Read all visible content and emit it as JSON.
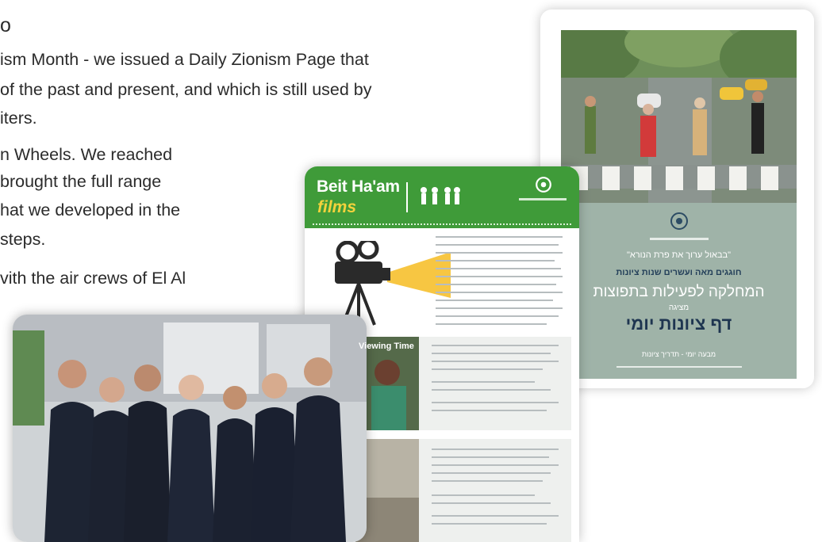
{
  "text": {
    "heading_fragment": "o",
    "para1_line1": "ism Month - we issued a Daily Zionism Page that",
    "para1_line2": "of the past and present, and which is still used by",
    "para1_line3": "iters.",
    "para2_line1": "n Wheels. We reached",
    "para2_line2": "brought the full range",
    "para2_line3": "hat we developed in the",
    "para2_line4": "steps.",
    "para3_line1": "vith the air crews of El Al"
  },
  "poster": {
    "quote": "\"בבאול ערוך את פרת הנורא\"",
    "line_small": "חוגגים מאה ועשרים שנות ציונות",
    "department": "המחלקה לפעילות בתפוצות",
    "presents": "מציגה",
    "title": "דף ציונות יומי",
    "footer": "מבעה יומי - תדריך ציונות"
  },
  "newsletter": {
    "brand": "Beit Ha'am",
    "brand_sub": "films",
    "section2_title": "Viewing Time"
  },
  "colors": {
    "poster_bg": "#9fb3a8",
    "banner_green": "#3f9b39",
    "accent_yellow": "#f3c52f"
  }
}
